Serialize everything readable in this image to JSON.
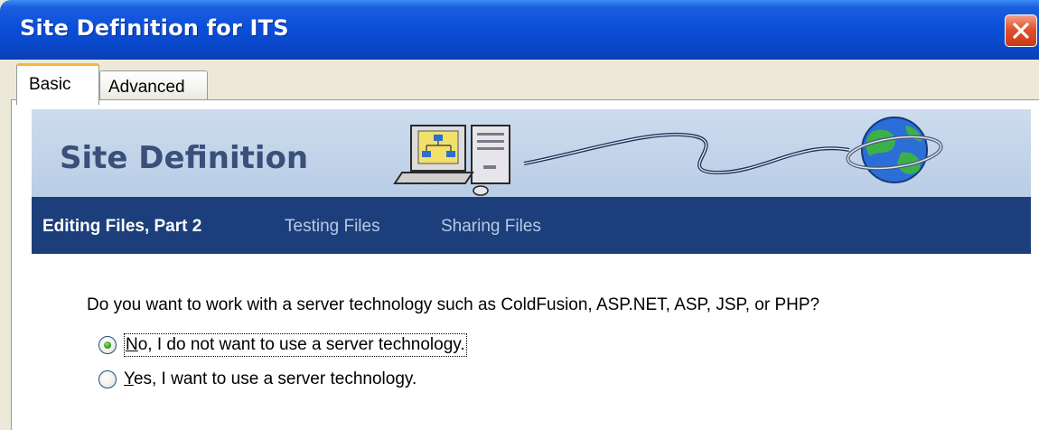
{
  "window": {
    "title": "Site Definition for ITS"
  },
  "tabs": [
    {
      "label": "Basic",
      "active": true
    },
    {
      "label": "Advanced",
      "active": false
    }
  ],
  "banner": {
    "heading": "Site Definition",
    "illustration": "computer-connected-to-globe"
  },
  "steps": [
    {
      "label": "Editing Files, Part 2",
      "current": true
    },
    {
      "label": "Testing Files",
      "current": false
    },
    {
      "label": "Sharing Files",
      "current": false
    }
  ],
  "question": "Do you want to work with a server technology such as ColdFusion, ASP.NET, ASP, JSP, or PHP?",
  "options": [
    {
      "label_mnemonic": "N",
      "label_rest": "o, I do not want to use a server technology.",
      "selected": true
    },
    {
      "label_mnemonic": "Y",
      "label_rest": "es, I want to use a server technology.",
      "selected": false
    }
  ],
  "colors": {
    "titlebar": "#0b4fd8",
    "banner": "#c3d5eb",
    "stepbar": "#1c3f7c",
    "heading": "#3a4f7a"
  }
}
